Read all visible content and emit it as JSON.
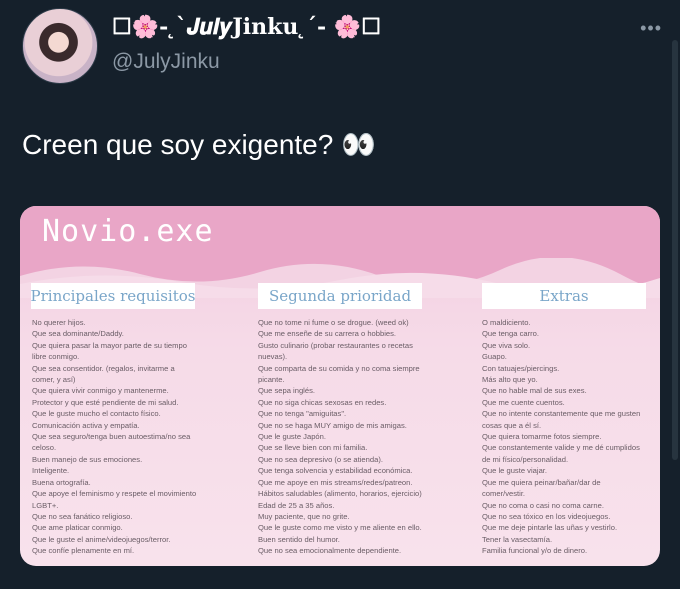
{
  "tweet": {
    "display_name": "☐🌸- ̨`𝑱𝒖𝒍𝒚Jinku ̨´- 🌸☐",
    "handle": "@JulyJinku",
    "more_label": "•••",
    "text": "Creen que soy exigente? 👀"
  },
  "media": {
    "title": "Novio.exe",
    "columns": [
      {
        "heading": "Principales requisitos",
        "items": [
          "No querer hijos.",
          "Que sea dominante/Daddy.",
          "Que quiera pasar la mayor parte de su tiempo",
          "libre conmigo.",
          "Que sea consentidor. (regalos, invitarme a",
          "comer, y así)",
          "Que quiera vivir conmigo y mantenerme.",
          "Protector y que esté pendiente de mi salud.",
          "Que le guste mucho el contacto físico.",
          "Comunicación activa y empatía.",
          "Que sea seguro/tenga buen autoestima/no sea",
          "celoso.",
          "Buen manejo de sus emociones.",
          "Inteligente.",
          "Buena ortografía.",
          "Que apoye el feminismo y respete el movimiento",
          "LGBT+.",
          "Que no sea fanático religioso.",
          "Que ame platicar conmigo.",
          "Que le guste el anime/videojuegos/terror.",
          "Que confíe plenamente en mí."
        ]
      },
      {
        "heading": "Segunda prioridad",
        "items": [
          "Que no tome ni fume o se drogue. (weed ok)",
          "Que me enseñe de su carrera o hobbies.",
          "Gusto culinario (probar restaurantes o recetas",
          "nuevas).",
          "Que comparta de su comida y no coma siempre",
          "picante.",
          "Que sepa inglés.",
          "Que no siga chicas sexosas en redes.",
          "Que no tenga \"amiguitas\".",
          "Que no se haga MUY amigo de mis amigas.",
          "Que le guste Japón.",
          "Que se lleve bien con mi familia.",
          "Que no sea depresivo (o se atienda).",
          "Que tenga solvencia y estabilidad económica.",
          "Que me apoye en mis streams/redes/patreon.",
          "Hábitos saludables (alimento, horarios, ejercicio)",
          "Edad de 25 a 35 años.",
          "Muy paciente, que no grite.",
          "Que le guste como me visto y me aliente en ello.",
          "Buen sentido del humor.",
          "Que no sea emocionalmente dependiente."
        ]
      },
      {
        "heading": "Extras",
        "items": [
          "O maldiciento.",
          "Que tenga carro.",
          "Que viva solo.",
          "Guapo.",
          "Con tatuajes/piercings.",
          "Más alto que yo.",
          "Que no hable mal de sus exes.",
          "Que me cuente cuentos.",
          "Que no intente constantemente que me gusten",
          "cosas que a él sí.",
          "Que quiera tomarme fotos siempre.",
          "Que constantemente valide y me dé cumplidos",
          "de mi físico/personalidad.",
          "Que le guste viajar.",
          "Que me quiera peinar/bañar/dar de",
          "comer/vestir.",
          "Que no coma o casi no coma carne.",
          "Que no sea tóxico en los videojuegos.",
          "Que me deje pintarle las uñas y vestirlo.",
          "Tener la vasectamía.",
          "Familia funcional y/o de dinero."
        ]
      }
    ]
  },
  "colors": {
    "background": "#15202b",
    "secondary_text": "#8b98a5",
    "media_top": "#e9a6c7",
    "column_heading": "#7aa6c9"
  }
}
